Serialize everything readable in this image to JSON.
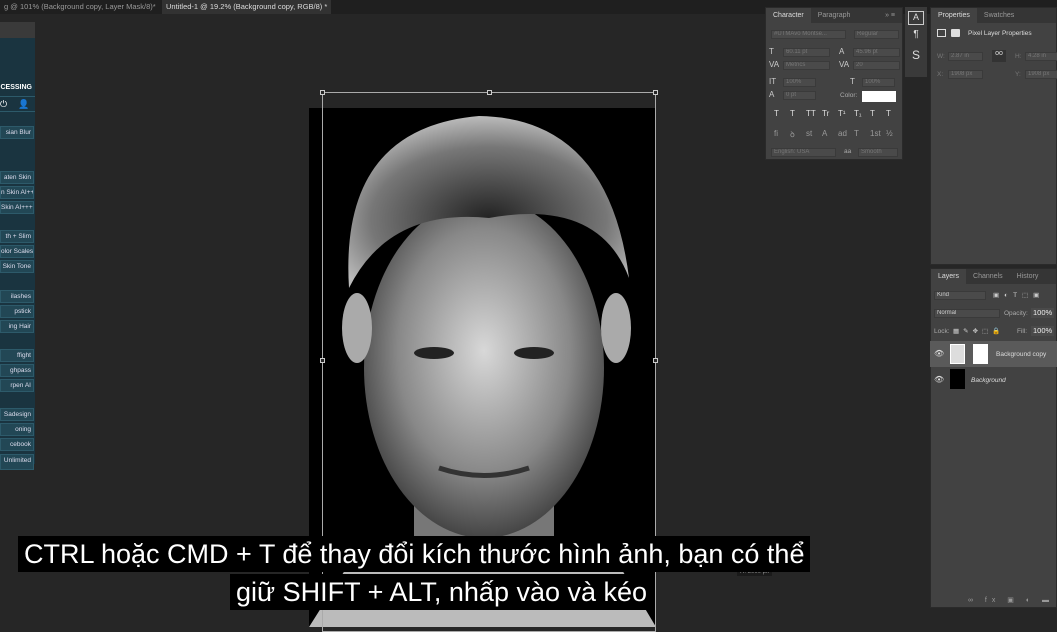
{
  "tabs": [
    "g @ 101% (Background copy, Layer Mask/8)*",
    "Untitled-1 @ 19.2% (Background copy, RGB/8) *"
  ],
  "left_panel": {
    "title": "CESSING",
    "buttons": [
      "sian Blur",
      "aten Skin",
      "n Skin AI++",
      "Skin AI+++",
      "th + Slim",
      "olor Scales",
      "Skin Tone",
      "ilashes",
      "pstick",
      "ing Hair",
      "ffight",
      "ghpass",
      "rpen AI",
      "Sadesign",
      "oning",
      "cebook",
      "Unlimited"
    ]
  },
  "character": {
    "tabs": [
      "Character",
      "Paragraph"
    ],
    "font": "#UTMAvo Montse...",
    "style": "Regular",
    "size": "60.11 pt",
    "leading": "45.96 pt",
    "kerning": "Metrics",
    "tracking": "20",
    "vscale": "100%",
    "hscale": "100%",
    "baseline": "0 pt",
    "color_label": "Color:",
    "color": "#ffffff",
    "language": "English: USA",
    "aa_icon": "aa",
    "antialias": "Smooth",
    "styles": [
      "T",
      "T",
      "TT",
      "Tr",
      "T¹",
      "T₁",
      "T",
      "T"
    ],
    "opentype": [
      "fi",
      "ꝺ",
      "st",
      "A",
      "ad",
      "T",
      "1st",
      "½"
    ]
  },
  "properties": {
    "tabs": [
      "Properties",
      "Swatches"
    ],
    "title": "Pixel Layer Properties",
    "w_label": "W:",
    "w": "2.87 in",
    "h_label": "H:",
    "h": "4.28 in",
    "x_label": "X:",
    "x": "1908 px",
    "y_label": "Y:",
    "y": "1908 px"
  },
  "layers": {
    "tabs": [
      "Layers",
      "Channels",
      "History"
    ],
    "kind": "Kind",
    "blend": "Normal",
    "opacity_label": "Opacity:",
    "opacity": "100%",
    "lock_label": "Lock:",
    "fill_label": "Fill:",
    "fill": "100%",
    "items": [
      {
        "name": "Background copy",
        "selected": true
      },
      {
        "name": "Background",
        "selected": false
      }
    ]
  },
  "canvas": {
    "size_tooltip": "H: 3000 px"
  },
  "caption": {
    "line1": "CTRL hoặc CMD + T để thay đổi kích thước hình ảnh, bạn có thể",
    "line2": "giữ SHIFT + ALT, nhấp vào  và kéo"
  }
}
